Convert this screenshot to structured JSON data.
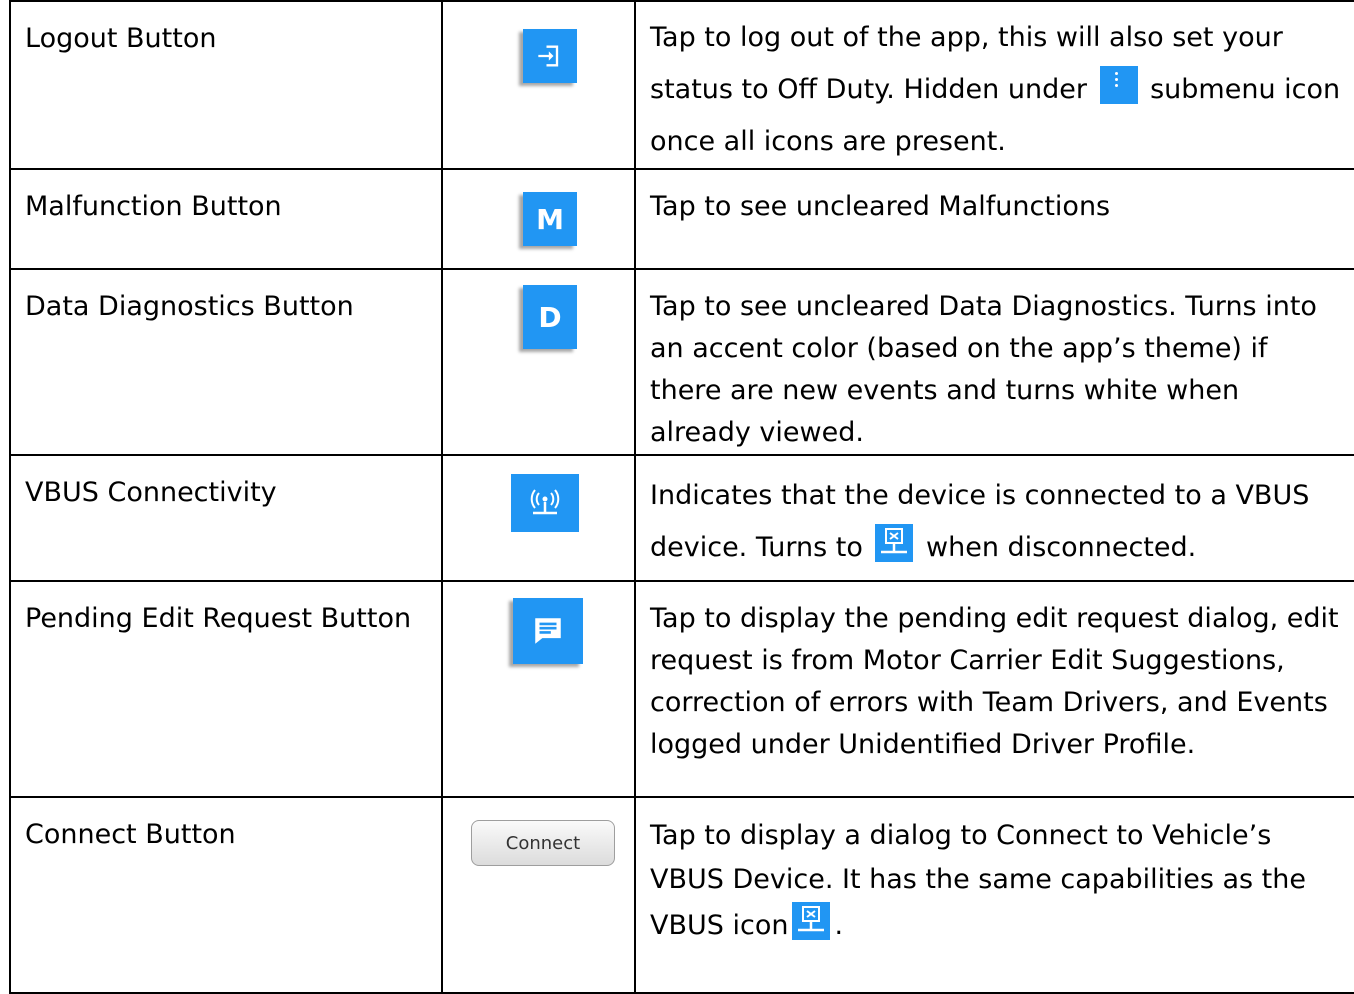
{
  "rows": [
    {
      "name": "Logout Button",
      "icon": "logout-icon",
      "desc_parts": [
        "Tap to log out of the app, this will also set your status to Off Duty. Hidden under",
        "submenu icon once all icons are present."
      ],
      "inline_icon": "submenu-dots-icon"
    },
    {
      "name": "Malfunction Button",
      "icon": "malfunction-m-icon",
      "icon_letter": "M",
      "desc": "Tap to see uncleared Malfunctions"
    },
    {
      "name": "Data Diagnostics Button",
      "icon": "data-diagnostics-d-icon",
      "icon_letter": "D",
      "desc": "Tap to see uncleared Data Diagnostics. Turns into an accent color (based on the app’s theme) if there are new events and turns white when already viewed."
    },
    {
      "name": "VBUS Connectivity",
      "icon": "vbus-connected-icon",
      "desc_parts": [
        "Indicates that the device is connected to a VBUS device. Turns to",
        "when disconnected."
      ],
      "inline_icon": "vbus-disconnected-icon"
    },
    {
      "name": "Pending Edit Request Button",
      "icon": "pending-edit-request-icon",
      "desc": "Tap to display the pending edit request dialog, edit request is from Motor Carrier Edit Suggestions, correction of errors with Team Drivers, and Events logged under Unidentified Driver Profile."
    },
    {
      "name": "Connect Button",
      "button_label": "Connect",
      "desc_parts": [
        "Tap to display a dialog to Connect to Vehicle’s VBUS Device. It has the same capabilities as the VBUS icon",
        "."
      ],
      "inline_icon": "vbus-disconnected-icon"
    }
  ],
  "colors": {
    "icon_blue": "#2196f3",
    "border": "#000000"
  }
}
